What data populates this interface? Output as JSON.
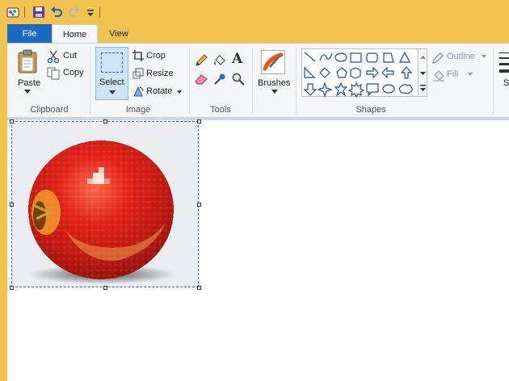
{
  "quick_access": {
    "icons": [
      "app-menu-icon",
      "save-icon",
      "undo-icon",
      "redo-icon",
      "customize-qat-icon"
    ]
  },
  "tabs": {
    "file": "File",
    "home": "Home",
    "view": "View"
  },
  "clipboard": {
    "label": "Clipboard",
    "paste": "Paste",
    "cut": "Cut",
    "copy": "Copy"
  },
  "image": {
    "label": "Image",
    "select": "Select",
    "crop": "Crop",
    "resize": "Resize",
    "rotate": "Rotate"
  },
  "tools": {
    "label": "Tools"
  },
  "brushes": {
    "label": "Brushes"
  },
  "shapes": {
    "label": "Shapes",
    "outline": "Outline",
    "fill": "Fill",
    "partial_next": "S"
  },
  "colors": {
    "accent": "#1c6ac5",
    "titlebar": "#f0c24e",
    "ribbon": "#f5f6f7",
    "selection_border": "#2b6cb0"
  }
}
